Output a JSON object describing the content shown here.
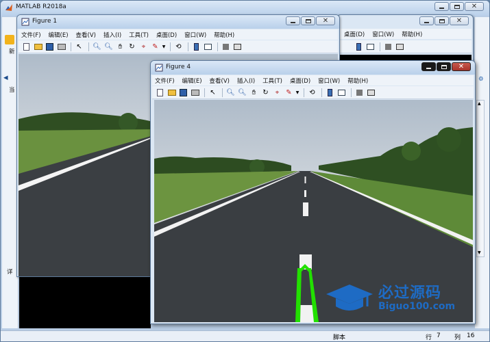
{
  "matlab": {
    "title": "MATLAB R2018a",
    "side_labels": [
      "新",
      "当",
      "详"
    ],
    "status": {
      "script": "脚本",
      "row_label": "行",
      "row": "7",
      "col_label": "列",
      "col": "16"
    }
  },
  "menus": [
    "文件(F)",
    "编辑(E)",
    "查看(V)",
    "插入(I)",
    "工具(T)",
    "桌面(D)",
    "窗口(W)",
    "帮助(H)"
  ],
  "background_menus": [
    "桌面(D)",
    "窗口(W)",
    "帮助(H)"
  ],
  "figure1": {
    "title": "Figure 1"
  },
  "figure4": {
    "title": "Figure 4"
  },
  "watermark": {
    "cn": "必过源码",
    "en": "Biguo100.com"
  },
  "colors": {
    "lane_highlight": "#22e000",
    "watermark": "#1e6bc4"
  }
}
